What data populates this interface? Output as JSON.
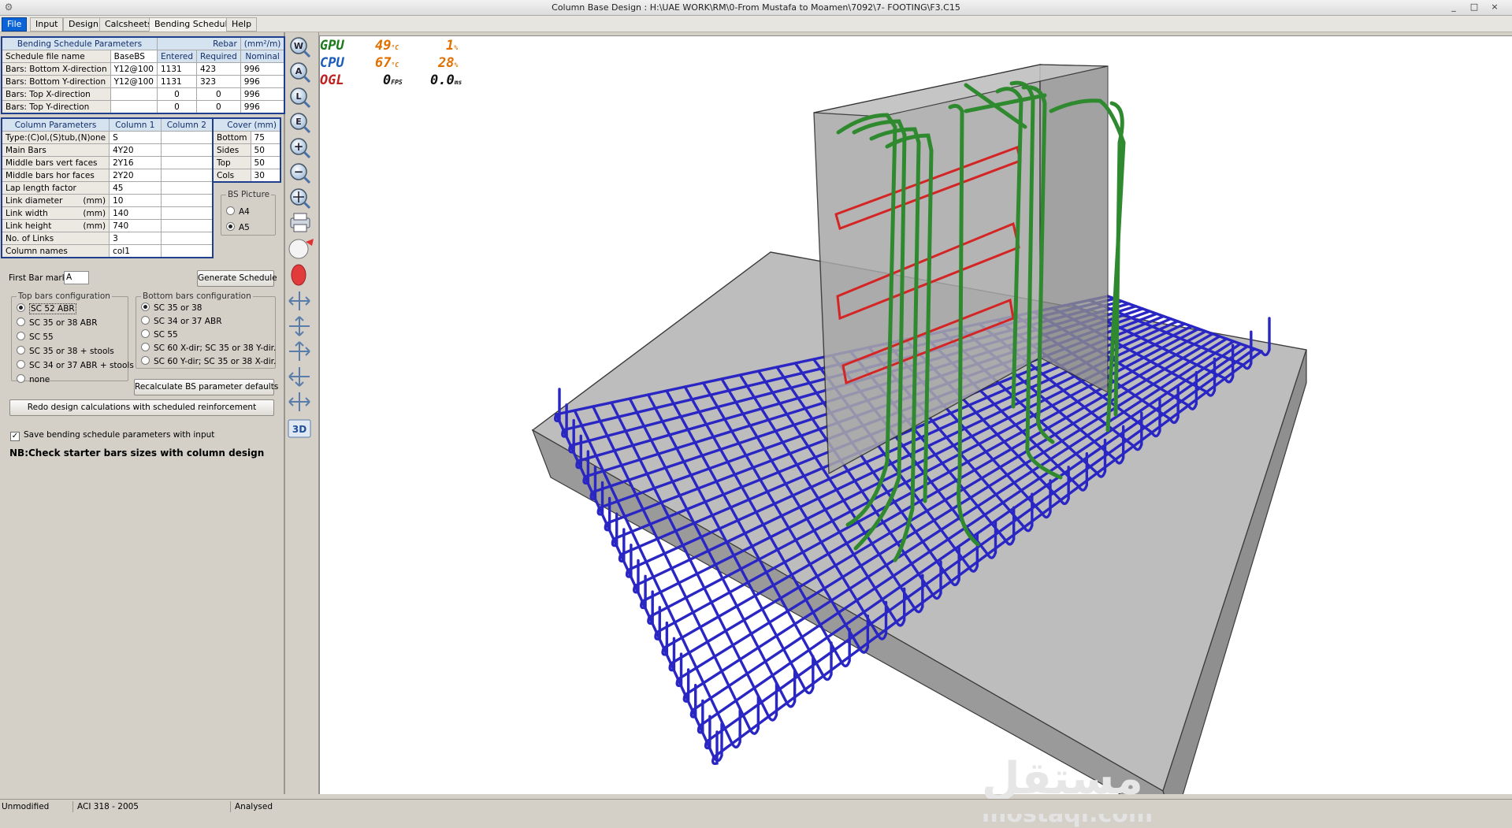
{
  "window": {
    "title": "Column Base Design :  H:\\UAE WORK\\RM\\0-From Mustafa to Moamen\\7092\\7- FOOTING\\F3.C15",
    "minimize": "_",
    "maximize": "□",
    "close": "×"
  },
  "menu": [
    "File",
    "Input",
    "Design",
    "Calcsheets",
    "Bending Schedule",
    "Help"
  ],
  "bs_params": {
    "header": "Bending Schedule Parameters",
    "rebar_header": "Rebar",
    "rebar_unit": "(mm²/m)",
    "columns": [
      "Entered",
      "Required",
      "Nominal"
    ],
    "rows": [
      {
        "label": "Schedule file name",
        "value": "BaseBS",
        "entered": "",
        "required": "",
        "nominal": ""
      },
      {
        "label": "Bars: Bottom X-direction",
        "value": "Y12@100",
        "entered": "1131",
        "required": "423",
        "nominal": "996"
      },
      {
        "label": "Bars: Bottom Y-direction",
        "value": "Y12@100",
        "entered": "1131",
        "required": "323",
        "nominal": "996"
      },
      {
        "label": "Bars: Top X-direction",
        "value": "",
        "entered": "0",
        "required": "0",
        "nominal": "996"
      },
      {
        "label": "Bars: Top Y-direction",
        "value": "",
        "entered": "0",
        "required": "0",
        "nominal": "996"
      }
    ]
  },
  "column_params": {
    "header": "Column Parameters",
    "col1": "Column 1",
    "col2": "Column 2",
    "rows": [
      {
        "label": "Type:(C)ol,(S)tub,(N)one",
        "unit": "",
        "c1": "S"
      },
      {
        "label": "Main Bars",
        "unit": "",
        "c1": "4Y20"
      },
      {
        "label": "Middle bars vert faces",
        "unit": "",
        "c1": "2Y16"
      },
      {
        "label": "Middle bars hor faces",
        "unit": "",
        "c1": "2Y20"
      },
      {
        "label": "Lap length factor",
        "unit": "",
        "c1": "45"
      },
      {
        "label": "Link diameter",
        "unit": "(mm)",
        "c1": "10"
      },
      {
        "label": "Link width",
        "unit": "(mm)",
        "c1": "140"
      },
      {
        "label": "Link height",
        "unit": "(mm)",
        "c1": "740"
      },
      {
        "label": "No. of Links",
        "unit": "",
        "c1": "3"
      },
      {
        "label": "Column names",
        "unit": "",
        "c1": "col1"
      }
    ]
  },
  "cover": {
    "header": "Cover (mm)",
    "rows": [
      {
        "label": "Bottom",
        "value": "75"
      },
      {
        "label": "Sides",
        "value": "50"
      },
      {
        "label": "Top",
        "value": "50"
      },
      {
        "label": "Cols",
        "value": "30"
      }
    ]
  },
  "bs_picture": {
    "legend": "BS Picture",
    "options": [
      {
        "label": "A4",
        "selected": false
      },
      {
        "label": "A5",
        "selected": true
      }
    ]
  },
  "first_bar_mark": {
    "label": "First Bar mark",
    "value": "A"
  },
  "generate_button": "Generate Schedule",
  "top_bars": {
    "legend": "Top bars configuration",
    "options": [
      {
        "label": "SC 52 ABR",
        "selected": true
      },
      {
        "label": "SC 35 or 38 ABR",
        "selected": false
      },
      {
        "label": "SC 55",
        "selected": false
      },
      {
        "label": "SC 35 or 38 + stools",
        "selected": false
      },
      {
        "label": "SC 34 or 37 ABR + stools",
        "selected": false
      },
      {
        "label": "none",
        "selected": false
      }
    ]
  },
  "bottom_bars": {
    "legend": "Bottom bars configuration",
    "options": [
      {
        "label": "SC 35 or 38",
        "selected": true
      },
      {
        "label": "SC 34 or 37 ABR",
        "selected": false
      },
      {
        "label": "SC 55",
        "selected": false
      },
      {
        "label": "SC 60 X-dir; SC 35 or 38 Y-dir.",
        "selected": false
      },
      {
        "label": "SC 60 Y-dir; SC 35 or 38 X-dir.",
        "selected": false
      }
    ]
  },
  "recalc_button": "Recalculate BS parameter defaults",
  "redo_button": "Redo design calculations with scheduled reinforcement",
  "save_checkbox": {
    "label": "Save bending schedule parameters with input",
    "checked": true
  },
  "note": "NB:Check starter bars sizes with column design",
  "toolbar": {
    "tools": [
      "W",
      "A",
      "L",
      "E",
      "zoom-in",
      "zoom-out",
      "pan",
      "print",
      "sphere",
      "egg",
      "move-x",
      "move-y",
      "move-z",
      "move-xy",
      "move-yz",
      "3D"
    ],
    "label_3d": "3D"
  },
  "perf": {
    "gpu_label": "GPU",
    "gpu_temp": "49",
    "gpu_temp_unit": "°C",
    "gpu_load": "1",
    "gpu_load_unit": "%",
    "cpu_label": "CPU",
    "cpu_temp": "67",
    "cpu_temp_unit": "°C",
    "cpu_load": "28",
    "cpu_load_unit": "%",
    "ogl_label": "OGL",
    "fps": "0",
    "fps_unit": "FPS",
    "ms": "0.0",
    "ms_unit": "ms"
  },
  "watermark": {
    "arabic": "مستقل",
    "latin": "mostaql.com"
  },
  "status": {
    "state": "Unmodified",
    "code": "ACI 318 - 2005",
    "analysis": "Analysed"
  },
  "colors": {
    "bottom_mesh": "#2020c8",
    "starter_bars": "#2e8b2e",
    "links": "#d02020",
    "concrete": "#b4b4b4"
  }
}
